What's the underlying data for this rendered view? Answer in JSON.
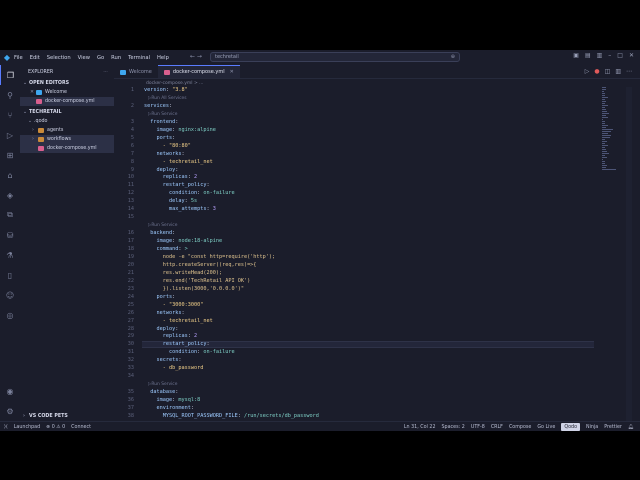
{
  "titlebar": {
    "menu": [
      "File",
      "Edit",
      "Selection",
      "View",
      "Go",
      "Run",
      "Terminal",
      "Help"
    ],
    "search": "techretail"
  },
  "sidebar": {
    "header": "EXPLORER",
    "open_editors_label": "OPEN EDITORS",
    "open_editors": [
      "Welcome",
      "docker-compose.yml"
    ],
    "project_label": "TECHRETAIL",
    "tree": [
      {
        "label": ".qodo",
        "depth": 0,
        "type": "folder"
      },
      {
        "label": "agents",
        "depth": 1,
        "type": "folder"
      },
      {
        "label": "workflows",
        "depth": 1,
        "type": "folder"
      },
      {
        "label": "docker-compose.yml",
        "depth": 1,
        "type": "file"
      }
    ],
    "bottom_label": "VS CODE PETS"
  },
  "editor": {
    "tabs": [
      "Welcome",
      "docker-compose.yml"
    ],
    "breadcrumb": "docker-compose.yml > ...",
    "lines": [
      {
        "n": "1",
        "t": "version: \"3.8\""
      },
      {
        "lens": "▷Run All Services"
      },
      {
        "n": "2",
        "t": "services:"
      },
      {
        "lens": "▷Run Service"
      },
      {
        "n": "3",
        "t": "  frontend:"
      },
      {
        "n": "4",
        "t": "    image: nginx:alpine"
      },
      {
        "n": "5",
        "t": "    ports:"
      },
      {
        "n": "6",
        "t": "      - \"80:80\""
      },
      {
        "n": "7",
        "t": "    networks:"
      },
      {
        "n": "8",
        "t": "      - techretail_net"
      },
      {
        "n": "9",
        "t": "    deploy:"
      },
      {
        "n": "10",
        "t": "      replicas: 2"
      },
      {
        "n": "11",
        "t": "      restart_policy:"
      },
      {
        "n": "12",
        "t": "        condition: on-failure"
      },
      {
        "n": "13",
        "t": "        delay: 5s"
      },
      {
        "n": "14",
        "t": "        max_attempts: 3"
      },
      {
        "n": "15",
        "t": ""
      },
      {
        "lens": "▷Run Service"
      },
      {
        "n": "16",
        "t": "  backend:"
      },
      {
        "n": "17",
        "t": "    image: node:18-alpine"
      },
      {
        "n": "18",
        "t": "    command: >"
      },
      {
        "n": "19",
        "t": "      node -e \"const http=require('http');"
      },
      {
        "n": "20",
        "t": "      http.createServer((req,res)=>{"
      },
      {
        "n": "21",
        "t": "      res.writeHead(200);"
      },
      {
        "n": "22",
        "t": "      res.end('TechRetail API OK')"
      },
      {
        "n": "23",
        "t": "      }).listen(3000,'0.0.0.0')\""
      },
      {
        "n": "24",
        "t": "    ports:"
      },
      {
        "n": "25",
        "t": "      - \"3000:3000\""
      },
      {
        "n": "26",
        "t": "    networks:"
      },
      {
        "n": "27",
        "t": "      - techretail_net"
      },
      {
        "n": "28",
        "t": "    deploy:"
      },
      {
        "n": "29",
        "t": "      replicas: 2"
      },
      {
        "n": "30",
        "t": "      restart_policy:"
      },
      {
        "n": "31",
        "t": "        condition: on-failure"
      },
      {
        "n": "32",
        "t": "    secrets:"
      },
      {
        "n": "33",
        "t": "      - db_password"
      },
      {
        "n": "34",
        "t": ""
      },
      {
        "lens": "▷Run Service"
      },
      {
        "n": "35",
        "t": "  database:"
      },
      {
        "n": "36",
        "t": "    image: mysql:8"
      },
      {
        "n": "37",
        "t": "    environment:"
      },
      {
        "n": "38",
        "t": "      MYSQL_ROOT_PASSWORD_FILE: /run/secrets/db_password"
      }
    ],
    "current_line": "30"
  },
  "status": {
    "left": [
      "Launchpad",
      "⊗ 0 ⚠ 0",
      "Connect"
    ],
    "right": [
      "Ln 31, Col 22",
      "Spaces: 2",
      "UTF-8",
      "CRLF",
      "Compose",
      "Go Live",
      "Qodo",
      "Ninja",
      "Prettier"
    ]
  },
  "colors": {
    "accent": "#5a7cff",
    "background": "#1b1d2b",
    "status_accent": "#3a5bd9"
  }
}
